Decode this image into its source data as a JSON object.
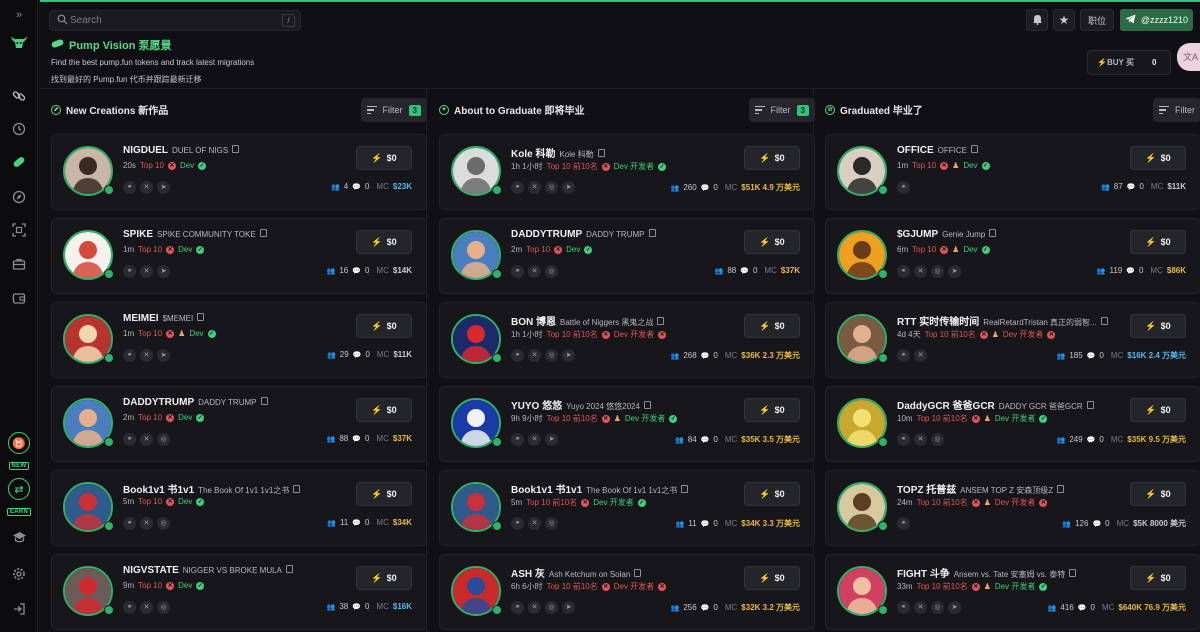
{
  "header": {
    "search_placeholder": "Search",
    "search_shortcut": "/",
    "position_label": "职位",
    "user_handle": "@zzzz1210"
  },
  "brand": {
    "title": "Pump Vision 泵愿景",
    "subtitle_en": "Find the best pump.fun tokens and track latest migrations",
    "subtitle_zh": "找到最好的 Pump.fun 代币并跟踪最新迁移"
  },
  "buy_box": {
    "label": "BUY 买",
    "value": "0"
  },
  "translate_icon": "文A",
  "sidebar": {
    "new_label": "NEW",
    "earn_label": "EARN"
  },
  "columns": [
    {
      "title": "New Creations 新作品",
      "filter_label": "Filter",
      "filter_count": "3",
      "cards": [
        {
          "name": "NIGDUEL",
          "fullname": "DUEL OF NIGS",
          "age": "20s",
          "top": "Top 10",
          "top_ok": false,
          "dev_label": "Dev",
          "dev_ok": true,
          "chef": false,
          "holders": "4",
          "comments": "0",
          "mc_label": "MC",
          "mc": "$23K",
          "mc_color": "blue",
          "buy": "$0",
          "socials": [
            "link",
            "x",
            "telegram"
          ],
          "avatar_bg": "#c8b7a6",
          "avatar_fg": "#3a2a20"
        },
        {
          "name": "SPIKE",
          "fullname": "SPIKE COMMUNITY TOKE",
          "age": "1m",
          "top": "Top 10",
          "top_ok": false,
          "dev_label": "Dev",
          "dev_ok": true,
          "chef": false,
          "holders": "16",
          "comments": "0",
          "mc_label": "MC",
          "mc": "$14K",
          "mc_color": "grey",
          "buy": "$0",
          "socials": [
            "link",
            "x",
            "telegram"
          ],
          "avatar_bg": "#f4f1ee",
          "avatar_fg": "#d24a3a"
        },
        {
          "name": "MEIMEI",
          "fullname": "$MEMEI",
          "age": "1m",
          "top": "Top 10",
          "top_ok": false,
          "dev_label": "Dev",
          "dev_ok": true,
          "chef": true,
          "holders": "29",
          "comments": "0",
          "mc_label": "MC",
          "mc": "$11K",
          "mc_color": "grey",
          "buy": "$0",
          "socials": [
            "link",
            "x",
            "telegram"
          ],
          "avatar_bg": "#b8322e",
          "avatar_fg": "#f2d6b0"
        },
        {
          "name": "DADDYTRUMP",
          "fullname": "DADDY TRUMP",
          "age": "2m",
          "top": "Top 10",
          "top_ok": false,
          "dev_label": "Dev",
          "dev_ok": true,
          "chef": false,
          "holders": "88",
          "comments": "0",
          "mc_label": "MC",
          "mc": "$37K",
          "mc_color": "yellow",
          "buy": "$0",
          "socials": [
            "link",
            "x",
            "web"
          ],
          "avatar_bg": "#4a7fbf",
          "avatar_fg": "#e8b08a"
        },
        {
          "name": "Book1v1 书1v1",
          "fullname": "The Book Of 1v1  1v1之书",
          "age": "5m",
          "top": "Top 10",
          "top_ok": false,
          "dev_label": "Dev",
          "dev_ok": true,
          "chef": false,
          "holders": "11",
          "comments": "0",
          "mc_label": "MC",
          "mc": "$34K",
          "mc_color": "yellow",
          "buy": "$0",
          "socials": [
            "link",
            "x",
            "web"
          ],
          "avatar_bg": "#2e5a8c",
          "avatar_fg": "#c8303a"
        },
        {
          "name": "NIGVSTATE",
          "fullname": "NIGGER VS BROKE MULA",
          "age": "9m",
          "top": "Top 10",
          "top_ok": false,
          "dev_label": "Dev",
          "dev_ok": true,
          "chef": false,
          "holders": "38",
          "comments": "0",
          "mc_label": "MC",
          "mc": "$16K",
          "mc_color": "blue",
          "buy": "$0",
          "socials": [
            "link",
            "x",
            "web"
          ],
          "avatar_bg": "#6a5a58",
          "avatar_fg": "#d02a30"
        }
      ]
    },
    {
      "title": "About to Graduate 即将毕业",
      "filter_label": "Filter",
      "filter_count": "3",
      "cards": [
        {
          "name": "Kole 科勒",
          "fullname": "Kole 科勒",
          "age": "1h 1小时",
          "top": "Top 10 前10名",
          "top_ok": false,
          "dev_label": "Dev 开发者",
          "dev_ok": true,
          "chef": false,
          "holders": "260",
          "comments": "0",
          "mc_label": "MC",
          "mc": "$51K 4.9 万美元",
          "mc_color": "yellow",
          "buy": "$0",
          "socials": [
            "link",
            "x",
            "web",
            "telegram"
          ],
          "avatar_bg": "#dcdcdc",
          "avatar_fg": "#6b6b6b"
        },
        {
          "name": "DADDYTRUMP",
          "fullname": "DADDY TRUMP",
          "age": "2m",
          "top": "Top 10",
          "top_ok": false,
          "dev_label": "Dev",
          "dev_ok": true,
          "chef": false,
          "holders": "88",
          "comments": "0",
          "mc_label": "MC",
          "mc": "$37K",
          "mc_color": "yellow",
          "buy": "$0",
          "socials": [
            "link",
            "x",
            "web"
          ],
          "avatar_bg": "#4a7fbf",
          "avatar_fg": "#e8b08a"
        },
        {
          "name": "BON 博恩",
          "fullname": "Battle of Niggers 黑鬼之战",
          "age": "1h 1小时",
          "top": "Top 10 前10名",
          "top_ok": false,
          "dev_label": "Dev 开发者",
          "dev_ok": false,
          "chef": false,
          "holders": "268",
          "comments": "0",
          "mc_label": "MC",
          "mc": "$36K 2.3 万美元",
          "mc_color": "yellow",
          "buy": "$0",
          "socials": [
            "link",
            "x",
            "web",
            "telegram"
          ],
          "avatar_bg": "#1c2a6a",
          "avatar_fg": "#d8282e"
        },
        {
          "name": "YUYO 悠悠",
          "fullname": "Yuyo 2024 悠悠2024",
          "age": "9h 9小时",
          "top": "Top 10 前10名",
          "top_ok": false,
          "dev_label": "Dev 开发者",
          "dev_ok": true,
          "chef": true,
          "holders": "84",
          "comments": "0",
          "mc_label": "MC",
          "mc": "$35K 3.5 万美元",
          "mc_color": "yellow",
          "buy": "$0",
          "socials": [
            "link",
            "x",
            "telegram"
          ],
          "avatar_bg": "#1a3aa8",
          "avatar_fg": "#f2f2f2"
        },
        {
          "name": "Book1v1 书1v1",
          "fullname": "The Book Of 1v1  1v1之书",
          "age": "5m",
          "top": "Top 10 前10名",
          "top_ok": false,
          "dev_label": "Dev 开发者",
          "dev_ok": true,
          "chef": false,
          "holders": "11",
          "comments": "0",
          "mc_label": "MC",
          "mc": "$34K 3.3 万美元",
          "mc_color": "yellow",
          "buy": "$0",
          "socials": [
            "link",
            "x",
            "web"
          ],
          "avatar_bg": "#2e5a8c",
          "avatar_fg": "#c8303a"
        },
        {
          "name": "ASH 灰",
          "fullname": "Ash Ketchum on Solan",
          "age": "6h 6小时",
          "top": "Top 10 前10名",
          "top_ok": false,
          "dev_label": "Dev 开发者",
          "dev_ok": false,
          "chef": false,
          "holders": "256",
          "comments": "0",
          "mc_label": "MC",
          "mc": "$32K 3.2 万美元",
          "mc_color": "yellow",
          "buy": "$0",
          "socials": [
            "link",
            "x",
            "web",
            "telegram"
          ],
          "avatar_bg": "#c82a2a",
          "avatar_fg": "#2a4a9a"
        }
      ]
    },
    {
      "title": "Graduated 毕业了",
      "filter_label": "Filter",
      "filter_count": "",
      "cards": [
        {
          "name": "OFFICE",
          "fullname": "OFFICE",
          "age": "1m",
          "top": "Top 10",
          "top_ok": false,
          "dev_label": "Dev",
          "dev_ok": true,
          "chef": true,
          "holders": "87",
          "comments": "0",
          "mc_label": "MC",
          "mc": "$11K",
          "mc_color": "grey",
          "buy": "$0",
          "socials": [
            "link"
          ],
          "avatar_bg": "#d8cfc2",
          "avatar_fg": "#2a2a2a"
        },
        {
          "name": "$GJUMP",
          "fullname": "Genie Jump",
          "age": "6m",
          "top": "Top 10",
          "top_ok": false,
          "dev_label": "Dev",
          "dev_ok": true,
          "chef": true,
          "holders": "119",
          "comments": "0",
          "mc_label": "MC",
          "mc": "$86K",
          "mc_color": "yellow",
          "buy": "$0",
          "socials": [
            "link",
            "x",
            "web",
            "telegram"
          ],
          "avatar_bg": "#f0a020",
          "avatar_fg": "#6a3a1a"
        },
        {
          "name": "RTT 实时传输时间",
          "fullname": "RealRetardTristan 真正的弱智...",
          "age": "4d 4天",
          "top": "Top 10 前10名",
          "top_ok": false,
          "dev_label": "Dev 开发者",
          "dev_ok": false,
          "chef": true,
          "holders": "185",
          "comments": "0",
          "mc_label": "MC",
          "mc": "$16K 2.4 万美元",
          "mc_color": "blue",
          "buy": "$0",
          "socials": [
            "link",
            "x"
          ],
          "avatar_bg": "#7a5a40",
          "avatar_fg": "#e0b090"
        },
        {
          "name": "DaddyGCR 爸爸GCR",
          "fullname": "DADDY GCR 爸爸GCR",
          "age": "10m",
          "top": "Top 10 前10名",
          "top_ok": false,
          "dev_label": "Dev 开发者",
          "dev_ok": true,
          "chef": true,
          "holders": "249",
          "comments": "0",
          "mc_label": "MC",
          "mc": "$35K 9.5 万美元",
          "mc_color": "yellow",
          "buy": "$0",
          "socials": [
            "link",
            "x",
            "web"
          ],
          "avatar_bg": "#c8a830",
          "avatar_fg": "#f4e070"
        },
        {
          "name": "TOPZ 托普兹",
          "fullname": "ANSEM TOP Z 安森顶级Z",
          "age": "24m",
          "top": "Top 10 前10名",
          "top_ok": false,
          "dev_label": "Dev 开发者",
          "dev_ok": false,
          "chef": true,
          "holders": "126",
          "comments": "0",
          "mc_label": "MC",
          "mc": "$5K 8000 美元",
          "mc_color": "grey",
          "buy": "$0",
          "socials": [
            "link"
          ],
          "avatar_bg": "#d8c8a0",
          "avatar_fg": "#5a4020"
        },
        {
          "name": "FIGHT 斗争",
          "fullname": "Ansem vs. Tate 安塞姆 vs. 泰特",
          "age": "33m",
          "top": "Top 10 前10名",
          "top_ok": false,
          "dev_label": "Dev 开发者",
          "dev_ok": true,
          "chef": true,
          "holders": "416",
          "comments": "0",
          "mc_label": "MC",
          "mc": "$640K 76.9 万美元",
          "mc_color": "yellow",
          "buy": "$0",
          "socials": [
            "link",
            "x",
            "web",
            "telegram"
          ],
          "avatar_bg": "#d04060",
          "avatar_fg": "#f0c0a0"
        }
      ]
    }
  ]
}
